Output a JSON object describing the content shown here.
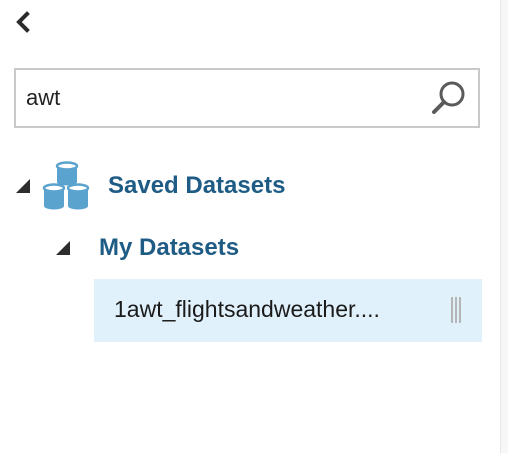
{
  "search": {
    "value": "awt"
  },
  "tree": {
    "root": {
      "label": "Saved Datasets",
      "icon": "database-icon"
    },
    "child": {
      "label": "My Datasets"
    },
    "items": [
      {
        "label": "1awt_flightsandweather...."
      }
    ]
  },
  "colors": {
    "tree_label": "#1f5c85",
    "selected_item_bg": "#e1f1fb",
    "database_icon": "#5ba3cf"
  }
}
